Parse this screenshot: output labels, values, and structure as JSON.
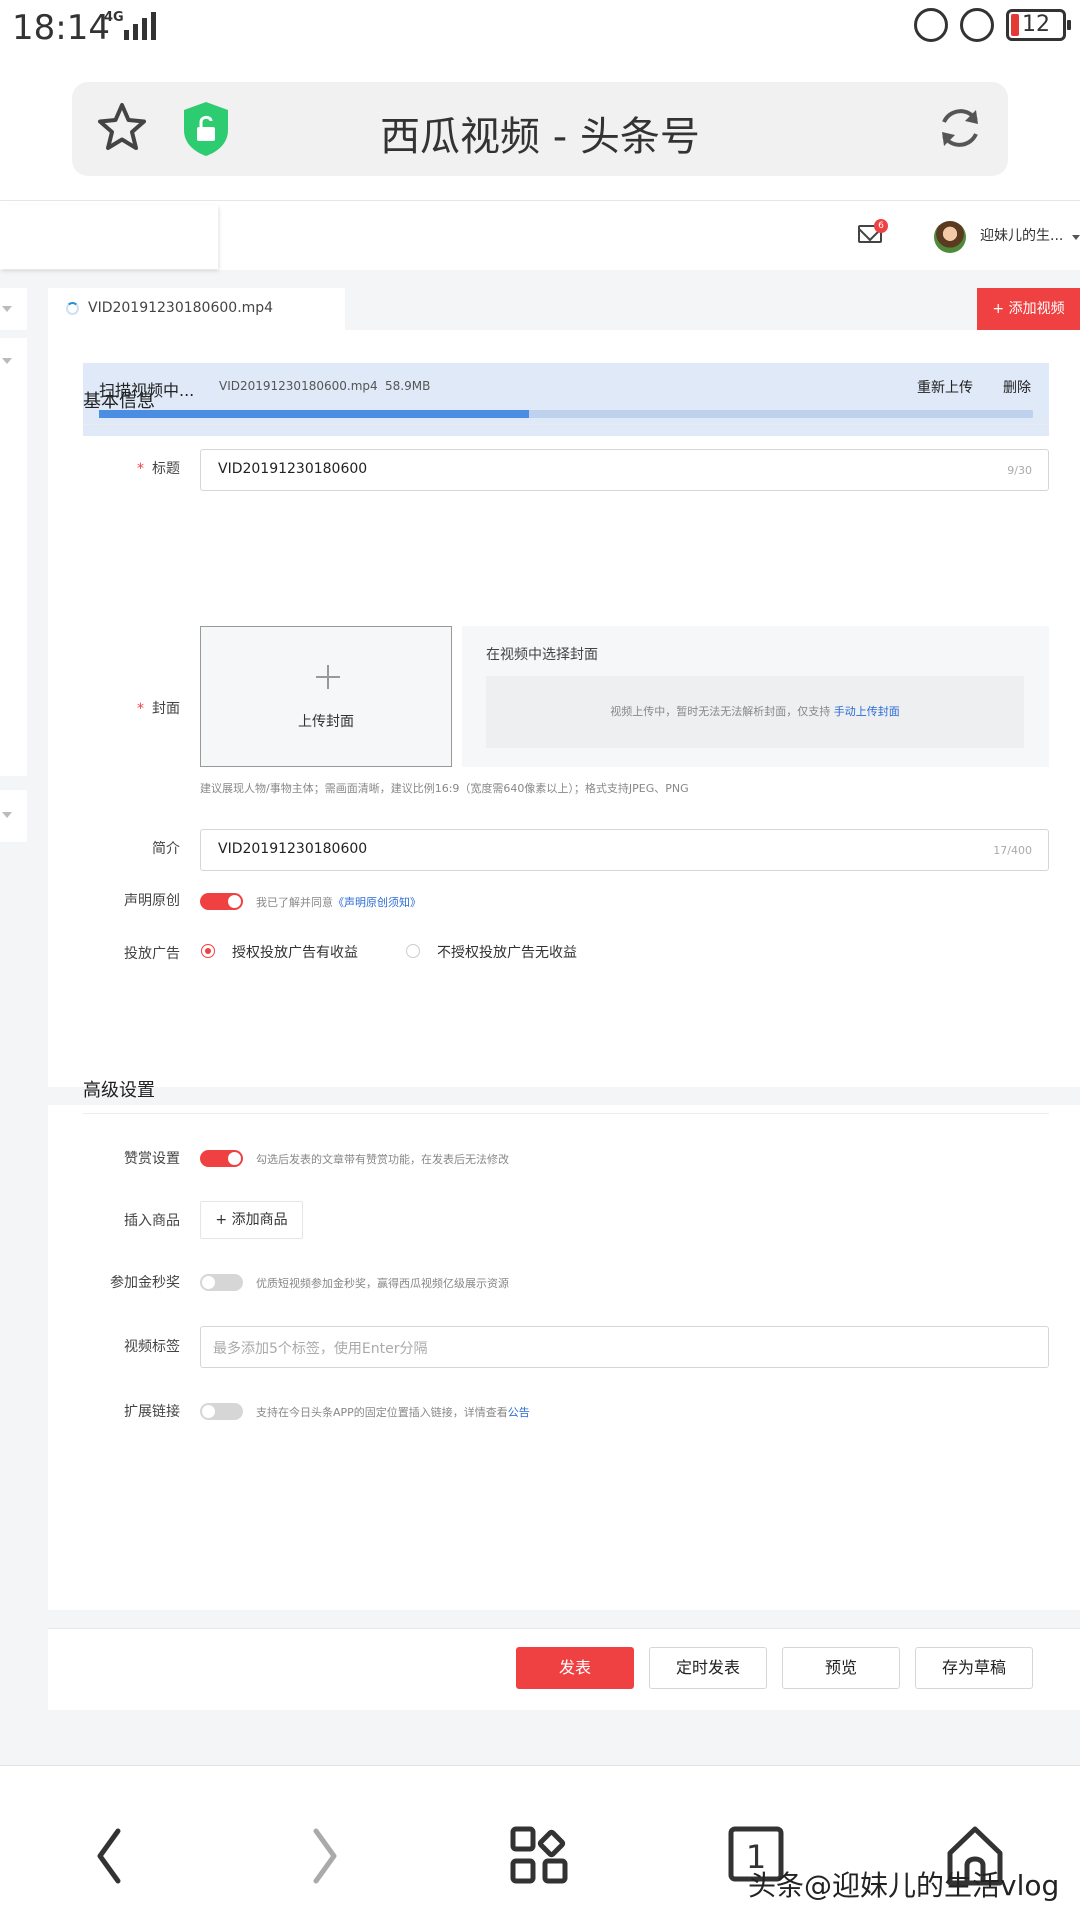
{
  "status_bar": {
    "time": "18:14",
    "network": "4G",
    "battery": "12"
  },
  "browser": {
    "title": "西瓜视频 - 头条号"
  },
  "topnav": {
    "mail_count": "6",
    "user_name": "迎妹儿的生..."
  },
  "file_tab": {
    "filename": "VID20191230180600.mp4",
    "add_video_label": "+ 添加视频"
  },
  "upload": {
    "status": "扫描视频中...",
    "filename": "VID20191230180600.mp4",
    "size": "58.9MB",
    "retry_label": "重新上传",
    "delete_label": "删除",
    "progress": 0.46
  },
  "basic": {
    "section_title": "基本信息",
    "title_label": "标题",
    "title_value": "VID20191230180600",
    "title_count": "9/30",
    "cover_label": "封面",
    "cover_upload_label": "上传封面",
    "cover_select_title": "在视频中选择封面",
    "cover_select_hint": "视频上传中，暂时无法无法解析封面，仅支持 ",
    "cover_select_link": "手动上传封面",
    "cover_tip": "建议展现人物/事物主体；需画面清晰，建议比例16:9（宽度需640像素以上）；格式支持JPEG、PNG",
    "intro_label": "简介",
    "intro_value": "VID20191230180600",
    "intro_count": "17/400",
    "original_label": "声明原创",
    "original_hint": "我已了解并同意",
    "original_link": "《声明原创须知》",
    "ads_label": "投放广告",
    "ads_option_yes": "授权投放广告有收益",
    "ads_option_no": "不授权投放广告无收益"
  },
  "advanced": {
    "section_title": "高级设置",
    "reward_label": "赞赏设置",
    "reward_hint": "勾选后发表的文章带有赞赏功能，在发表后无法修改",
    "product_label": "插入商品",
    "product_button": "+ 添加商品",
    "golden_label": "参加金秒奖",
    "golden_hint": "优质短视频参加金秒奖，赢得西瓜视频亿级展示资源",
    "tags_label": "视频标签",
    "tags_placeholder": "最多添加5个标签，使用Enter分隔",
    "link_label": "扩展链接",
    "link_hint": "支持在今日头条APP的固定位置插入链接，详情查看",
    "link_link": "公告"
  },
  "footer": {
    "publish": "发表",
    "schedule": "定时发表",
    "preview": "预览",
    "draft": "存为草稿"
  },
  "watermark": "头条@迎妹儿的生活vlog",
  "colors": {
    "accent": "#f04142",
    "link": "#2a6cd6",
    "progress": "#4a8de3",
    "shield": "#2ecc71"
  }
}
